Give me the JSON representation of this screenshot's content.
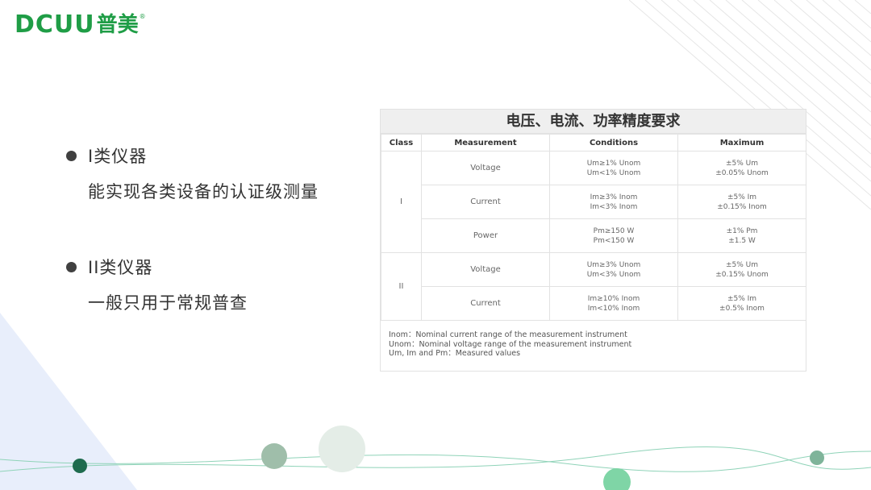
{
  "logo": {
    "en": "DCUU",
    "cn": "普美",
    "reg": "®"
  },
  "bullets": [
    {
      "title": "I类仪器",
      "desc": "能实现各类设备的认证级测量"
    },
    {
      "title": "II类仪器",
      "desc": "一般只用于常规普查"
    }
  ],
  "table": {
    "title": "电压、电流、功率精度要求",
    "headers": [
      "Class",
      "Measurement",
      "Conditions",
      "Maximum"
    ],
    "class_i": "I",
    "class_ii": "II",
    "rows": [
      {
        "measurement": "Voltage",
        "cond1": "Um≥1% Unom",
        "cond2": "Um<1% Unom",
        "max1": "±5% Um",
        "max2": "±0.05% Unom"
      },
      {
        "measurement": "Current",
        "cond1": "Im≥3% Inom",
        "cond2": "Im<3% Inom",
        "max1": "±5% Im",
        "max2": "±0.15% Inom"
      },
      {
        "measurement": "Power",
        "cond1": "Pm≥150 W",
        "cond2": "Pm<150 W",
        "max1": "±1% Pm",
        "max2": "±1.5 W"
      },
      {
        "measurement": "Voltage",
        "cond1": "Um≥3% Unom",
        "cond2": "Um<3% Unom",
        "max1": "±5% Um",
        "max2": "±0.15% Unom"
      },
      {
        "measurement": "Current",
        "cond1": "Im≥10% Inom",
        "cond2": "Im<10% Inom",
        "max1": "±5% Im",
        "max2": "±0.5% Inom"
      }
    ],
    "notes": [
      "Inom：Nominal current range of the measurement instrument",
      "Unom：Nominal voltage range of the measurement instrument",
      "Um, Im and Pm：Measured values"
    ]
  },
  "colors": {
    "brand": "#1f9d46",
    "dot": "#404040"
  }
}
